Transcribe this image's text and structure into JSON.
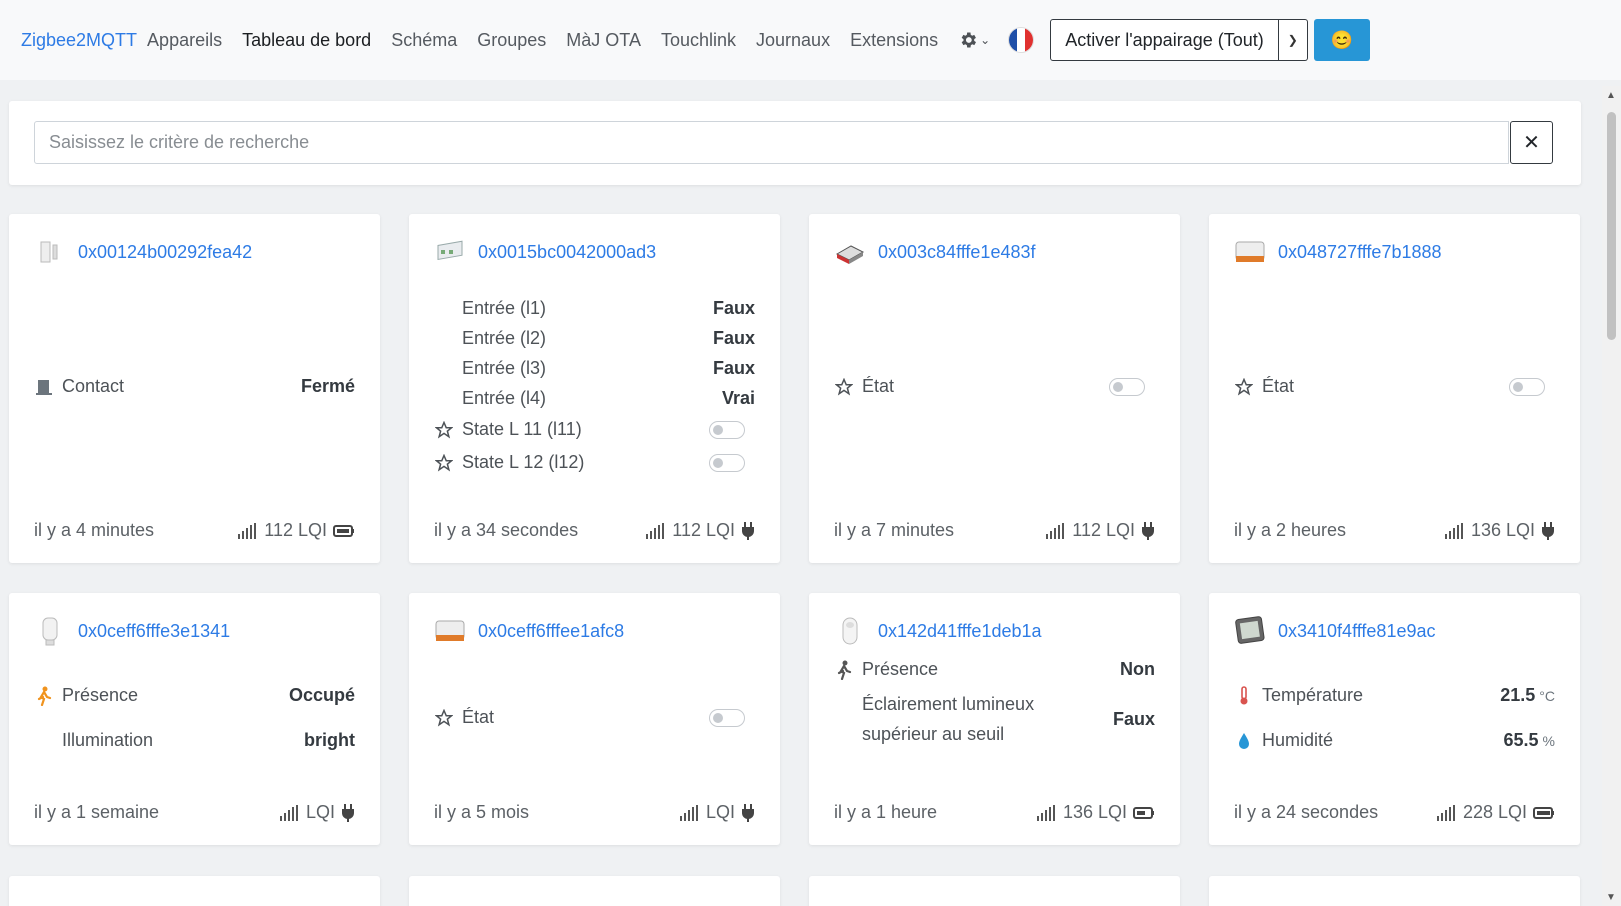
{
  "nav": {
    "brand": "Zigbee2MQTT",
    "links": [
      "Appareils",
      "Tableau de bord",
      "Schéma",
      "Groupes",
      "MàJ OTA",
      "Touchlink",
      "Journaux",
      "Extensions"
    ],
    "active_index": 1,
    "pair_button": "Activer l'appairage (Tout)",
    "smile": "😊"
  },
  "search": {
    "placeholder": "Saisissez le critère de recherche",
    "value": "",
    "clear": "✕"
  },
  "devices": [
    {
      "name": "0x00124b00292fea42",
      "features": [
        {
          "label": "Contact",
          "value": "Fermé"
        }
      ],
      "last_seen": "il y a 4 minutes",
      "lqi": "112 LQI",
      "power": "battery"
    },
    {
      "name": "0x0015bc0042000ad3",
      "features": [
        {
          "label": "Entrée (l1)",
          "value": "Faux"
        },
        {
          "label": "Entrée (l2)",
          "value": "Faux"
        },
        {
          "label": "Entrée (l3)",
          "value": "Faux"
        },
        {
          "label": "Entrée (l4)",
          "value": "Vrai"
        },
        {
          "label": "State L 11 (l11)"
        },
        {
          "label": "State L 12 (l12)"
        }
      ],
      "last_seen": "il y a 34 secondes",
      "lqi": "112 LQI",
      "power": "plug"
    },
    {
      "name": "0x003c84fffe1e483f",
      "features": [
        {
          "label": "État"
        }
      ],
      "last_seen": "il y a 7 minutes",
      "lqi": "112 LQI",
      "power": "plug"
    },
    {
      "name": "0x048727fffe7b1888",
      "features": [
        {
          "label": "État"
        }
      ],
      "last_seen": "il y a 2 heures",
      "lqi": "136 LQI",
      "power": "plug"
    },
    {
      "name": "0x0ceff6fffe3e1341",
      "features": [
        {
          "label": "Présence",
          "value": "Occupé"
        },
        {
          "label": "Illumination",
          "value": "bright"
        }
      ],
      "last_seen": "il y a 1 semaine",
      "lqi": "LQI",
      "power": "plug"
    },
    {
      "name": "0x0ceff6fffee1afc8",
      "features": [
        {
          "label": "État"
        }
      ],
      "last_seen": "il y a 5 mois",
      "lqi": "LQI",
      "power": "plug"
    },
    {
      "name": "0x142d41fffe1deb1a",
      "features": [
        {
          "label": "Présence",
          "value": "Non"
        },
        {
          "label_line1": "Éclairement lumineux",
          "label_line2": "supérieur au seuil",
          "value": "Faux"
        }
      ],
      "last_seen": "il y a 1 heure",
      "lqi": "136 LQI",
      "power": "battery"
    },
    {
      "name": "0x3410f4fffe81e9ac",
      "features": [
        {
          "label": "Température",
          "value": "21.5",
          "unit": "°C"
        },
        {
          "label": "Humidité",
          "value": "65.5",
          "unit": "%"
        }
      ],
      "last_seen": "il y a 24 secondes",
      "lqi": "228 LQI",
      "power": "battery"
    }
  ],
  "colors": {
    "link": "#2d7be5",
    "accent_button": "#2796d6",
    "text": "#343a40"
  }
}
